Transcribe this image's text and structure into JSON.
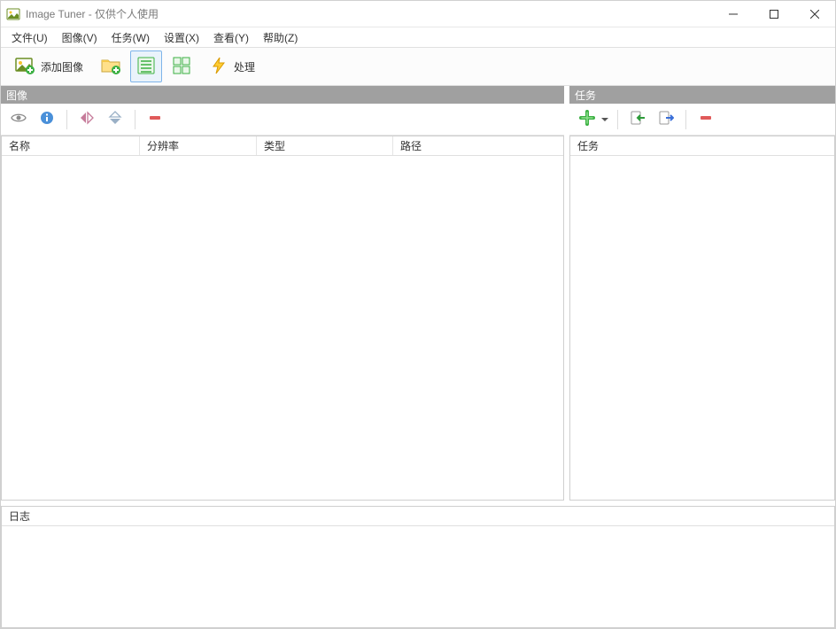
{
  "window": {
    "title": "Image Tuner - 仅供个人使用"
  },
  "menu": {
    "file": "文件(U)",
    "image": "图像(V)",
    "tasks": "任务(W)",
    "settings": "设置(X)",
    "view": "查看(Y)",
    "help": "帮助(Z)"
  },
  "toolbar": {
    "add_image": "添加图像",
    "process": "处理"
  },
  "sections": {
    "images": "图像",
    "tasks": "任务"
  },
  "image_list": {
    "columns": {
      "name": "名称",
      "resolution": "分辨率",
      "type": "类型",
      "path": "路径"
    },
    "rows": []
  },
  "tasks_panel": {
    "header": "任务",
    "rows": []
  },
  "log": {
    "header": "日志"
  }
}
